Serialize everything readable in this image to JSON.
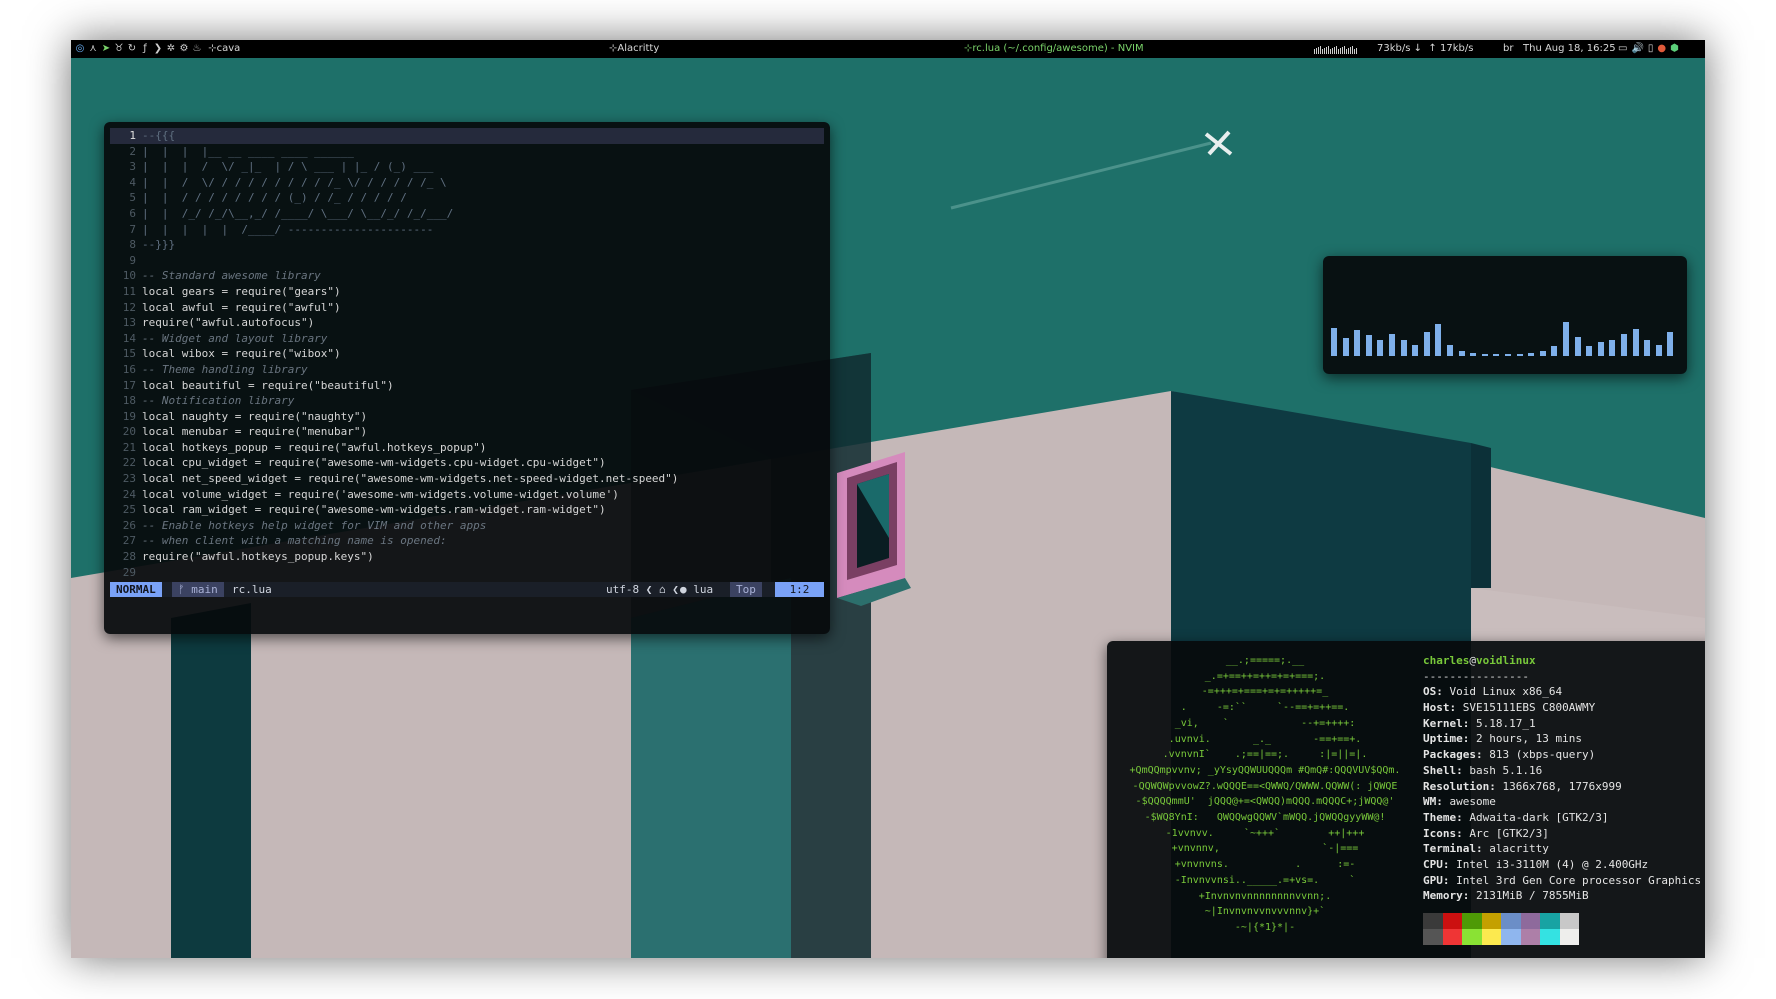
{
  "topbar": {
    "launcher_icons": [
      "void-logo-icon",
      "arrow-icon",
      "leaf-icon",
      "cat-icon",
      "refresh-icon",
      "fedora-icon",
      "terminal-prompt-icon",
      "gear-icon",
      "cog-icon",
      "flame-icon"
    ],
    "launcher_label": "⊹cava",
    "window_title_alacritty": "⊹Alacritty",
    "window_title_nvim": "⊹rc.lua (~/.config/awesome) - NVIM",
    "net_down": "73kb/s",
    "net_up": "17kb/s",
    "keyboard_layout": "br",
    "datetime": "Thu Aug 18, 16:25",
    "tray_icons": [
      "screen-icon",
      "volume-icon",
      "battery-icon",
      "browser-icon",
      "network-icon"
    ]
  },
  "nvim": {
    "lines": [
      {
        "num": "1",
        "text": "--{{{",
        "kind": "a"
      },
      {
        "num": "2",
        "text": "|  |  |  |__ __ ____ ____ ______",
        "kind": "a"
      },
      {
        "num": "3",
        "text": "|  |  |  /  \\/ _|_  | / \\ ___ | |_ / (_) ___",
        "kind": "a"
      },
      {
        "num": "4",
        "text": "|  |  /  \\/ / / / / / / / / /_ \\/ / / / / /_ \\",
        "kind": "a"
      },
      {
        "num": "5",
        "text": "|  |  / / / / / / / / (_) / /_ / / / / /",
        "kind": "a"
      },
      {
        "num": "6",
        "text": "|  |  /_/ /_/\\__,_/ /____/ \\___/ \\__/_/ /_/___/",
        "kind": "a"
      },
      {
        "num": "7",
        "text": "|  |  |  |  |  /____/ ----------------------",
        "kind": "a"
      },
      {
        "num": "8",
        "text": "--}}}",
        "kind": "a"
      },
      {
        "num": "9",
        "text": "",
        "kind": "p"
      },
      {
        "num": "10",
        "text": "-- Standard awesome library",
        "kind": "c"
      },
      {
        "num": "11",
        "text": "local gears = require(\"gears\")",
        "kind": "p"
      },
      {
        "num": "12",
        "text": "local awful = require(\"awful\")",
        "kind": "p"
      },
      {
        "num": "13",
        "text": "require(\"awful.autofocus\")",
        "kind": "p"
      },
      {
        "num": "14",
        "text": "-- Widget and layout library",
        "kind": "c"
      },
      {
        "num": "15",
        "text": "local wibox = require(\"wibox\")",
        "kind": "p"
      },
      {
        "num": "16",
        "text": "-- Theme handling library",
        "kind": "c"
      },
      {
        "num": "17",
        "text": "local beautiful = require(\"beautiful\")",
        "kind": "p"
      },
      {
        "num": "18",
        "text": "-- Notification library",
        "kind": "c"
      },
      {
        "num": "19",
        "text": "local naughty = require(\"naughty\")",
        "kind": "p"
      },
      {
        "num": "20",
        "text": "local menubar = require(\"menubar\")",
        "kind": "p"
      },
      {
        "num": "21",
        "text": "local hotkeys_popup = require(\"awful.hotkeys_popup\")",
        "kind": "p"
      },
      {
        "num": "22",
        "text": "local cpu_widget = require(\"awesome-wm-widgets.cpu-widget.cpu-widget\")",
        "kind": "p"
      },
      {
        "num": "23",
        "text": "local net_speed_widget = require(\"awesome-wm-widgets.net-speed-widget.net-speed\")",
        "kind": "p"
      },
      {
        "num": "24",
        "text": "local volume_widget = require('awesome-wm-widgets.volume-widget.volume')",
        "kind": "p"
      },
      {
        "num": "25",
        "text": "local ram_widget = require(\"awesome-wm-widgets.ram-widget.ram-widget\")",
        "kind": "p"
      },
      {
        "num": "26",
        "text": "-- Enable hotkeys help widget for VIM and other apps",
        "kind": "c"
      },
      {
        "num": "27",
        "text": "-- when client with a matching name is opened:",
        "kind": "c"
      },
      {
        "num": "28",
        "text": "require(\"awful.hotkeys_popup.keys\")",
        "kind": "p"
      },
      {
        "num": "29",
        "text": "",
        "kind": "p"
      }
    ],
    "statusline": {
      "mode": "NORMAL",
      "branch": "ᚠ main",
      "filename": "rc.lua",
      "encoding": "utf-8 ❮ ⌂ ❮",
      "filetype": "● lua",
      "percent": "Top",
      "position": "1:2"
    }
  },
  "cava": {
    "levels": [
      0.35,
      0.22,
      0.33,
      0.26,
      0.2,
      0.28,
      0.2,
      0.14,
      0.3,
      0.4,
      0.14,
      0.06,
      0.04,
      0.03,
      0.03,
      0.03,
      0.03,
      0.04,
      0.06,
      0.12,
      0.42,
      0.24,
      0.12,
      0.18,
      0.2,
      0.28,
      0.34,
      0.2,
      0.14,
      0.3
    ],
    "bar_color": "#7eb0ea"
  },
  "neofetch": {
    "logo_lines": [
      "__.;=====;.__",
      "_.=+==++=++=+=+===;.",
      "-=+++=+===+=+=+++++=_",
      ".     -=:``     `--==+=++==.",
      "_vi,    `            --+=++++:",
      ".uvnvi.       _._       -==+==+.",
      ".vvnvnI`    .;==|==;.     :|=||=|.",
      "+QmQQmpvvnv; _yYsyQQWUUQQQm #QmQ#:QQQVUV$QQm.",
      "-QQWQWpvvowZ?.wQQQE==<QWWQ/QWWW.QQWW(: jQWQE",
      "-$QQQQmmU'  jQQQ@+=<QWQQ)mQQQ.mQQQC+;jWQQ@'",
      "-$WQ8YnI:   QWQQwgQQWV`mWQQ.jQWQQgyyWW@!",
      "-1vvnvv.     `~+++`        ++|+++",
      "+vnvnnv,                 `-|===",
      "+vnvnvns.           .      :=-",
      "-Invnvvnsi.._____.=+vs=.     `",
      "+Invnvnvnnnnnnnnvvnn;.",
      "~|Invnvnvvnvvvnnv}+`",
      "-~|{*1}*|-"
    ],
    "user": "charles",
    "at": "@",
    "host": "voidlinux",
    "separator": "----------------",
    "rows": [
      {
        "key": "OS",
        "value": "Void Linux x86_64"
      },
      {
        "key": "Host",
        "value": "SVE15111EBS C800AWMY"
      },
      {
        "key": "Kernel",
        "value": "5.18.17_1"
      },
      {
        "key": "Uptime",
        "value": "2 hours, 13 mins"
      },
      {
        "key": "Packages",
        "value": "813 (xbps-query)"
      },
      {
        "key": "Shell",
        "value": "bash 5.1.16"
      },
      {
        "key": "Resolution",
        "value": "1366x768, 1776x999"
      },
      {
        "key": "WM",
        "value": "awesome"
      },
      {
        "key": "Theme",
        "value": "Adwaita-dark [GTK2/3]"
      },
      {
        "key": "Icons",
        "value": "Arc [GTK2/3]"
      },
      {
        "key": "Terminal",
        "value": "alacritty"
      },
      {
        "key": "CPU",
        "value": "Intel i3-3110M (4) @ 2.400GHz"
      },
      {
        "key": "GPU",
        "value": "Intel 3rd Gen Core processor Graphics"
      },
      {
        "key": "Memory",
        "value": "2131MiB / 7855MiB"
      }
    ],
    "palette": [
      "#3a3a3a",
      "#cc1010",
      "#4e9a06",
      "#c4a000",
      "#6b8ec7",
      "#8e6a9c",
      "#18a3a3",
      "#c8c8c8",
      "#555555",
      "#ef3535",
      "#8ae234",
      "#fce94f",
      "#8fb6ee",
      "#ad7fa8",
      "#34e2e2",
      "#eeeeec"
    ]
  },
  "colors": {
    "wallpaper_sky": "#1e7069",
    "wallpaper_wall": "#c5b8b8",
    "accent_blue": "#7aa2f7",
    "logo_green": "#78c83a"
  }
}
